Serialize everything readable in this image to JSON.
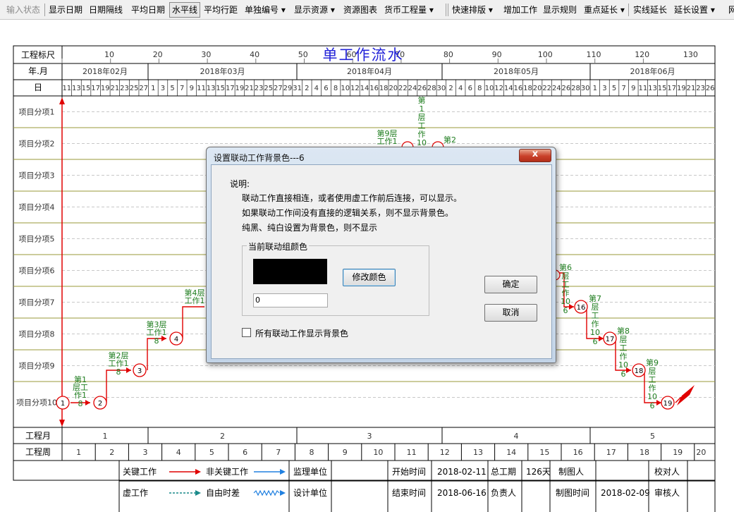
{
  "toolbar": {
    "items": [
      {
        "label": "输入状态",
        "state": "disabled"
      },
      {
        "label": "显示日期",
        "state": "normal"
      },
      {
        "label": "日期隔线",
        "state": "normal"
      },
      {
        "label": "平均日期",
        "state": "normal"
      },
      {
        "label": "水平线",
        "state": "active"
      },
      {
        "label": "平均行距",
        "state": "normal"
      },
      {
        "label": "单独编号 ▾",
        "state": "normal"
      },
      {
        "label": "显示资源 ▾",
        "state": "normal"
      },
      {
        "label": "资源图表",
        "state": "normal"
      },
      {
        "label": "货币工程量 ▾",
        "state": "normal"
      },
      {
        "label": "快速排版 ▾",
        "state": "normal"
      },
      {
        "label": "增加工作",
        "state": "normal"
      },
      {
        "label": "显示规则",
        "state": "normal"
      },
      {
        "label": "重点延长 ▾",
        "state": "normal"
      },
      {
        "label": "实线延长",
        "state": "normal"
      },
      {
        "label": "延长设置 ▾",
        "state": "normal"
      },
      {
        "label": "网",
        "state": "normal"
      }
    ]
  },
  "chart": {
    "title": "单工作流水",
    "scale_label": "工程标尺",
    "yearmonth_label": "年.月",
    "day_label": "日",
    "scale_ticks": [
      "10",
      "20",
      "30",
      "40",
      "50",
      "60",
      "70",
      "80",
      "90",
      "100",
      "110",
      "120",
      "130"
    ],
    "months": [
      "2018年02月",
      "2018年03月",
      "2018年04月",
      "2018年05月",
      "2018年06月"
    ],
    "days": [
      "11",
      "13",
      "15",
      "17",
      "19",
      "21",
      "23",
      "25",
      "27",
      "1",
      "3",
      "5",
      "7",
      "9",
      "11",
      "13",
      "15",
      "17",
      "19",
      "21",
      "23",
      "25",
      "27",
      "29",
      "31",
      "2",
      "4",
      "6",
      "8",
      "10",
      "12",
      "14",
      "16",
      "18",
      "20",
      "22",
      "24",
      "26",
      "28",
      "30",
      "2",
      "4",
      "6",
      "8",
      "10",
      "12",
      "14",
      "16",
      "18",
      "20",
      "22",
      "24",
      "26",
      "28",
      "30",
      "1",
      "3",
      "5",
      "7",
      "9",
      "11",
      "13",
      "15",
      "17",
      "19",
      "21",
      "23",
      "26"
    ],
    "rows": [
      "项目分项1",
      "项目分项2",
      "项目分项3",
      "项目分项4",
      "项目分项5",
      "项目分项6",
      "项目分项7",
      "项目分项8",
      "项目分项9",
      "项目分项10"
    ],
    "work_month_label": "工程月",
    "work_months": [
      "1",
      "2",
      "3",
      "4",
      "5"
    ],
    "work_week_label": "工程周",
    "work_weeks": [
      "1",
      "2",
      "3",
      "4",
      "5",
      "6",
      "7",
      "8",
      "9",
      "10",
      "11",
      "12",
      "13",
      "14",
      "15",
      "16",
      "17",
      "18",
      "19",
      "20"
    ],
    "nodes": [
      "1",
      "2",
      "3",
      "4",
      "16",
      "17",
      "18",
      "19",
      "1",
      "2"
    ],
    "node_labels": {
      "n1": "1",
      "n2": "2",
      "n3": "3",
      "n4": "4",
      "n16": "16",
      "n17": "17",
      "n18": "18",
      "n19": "19"
    },
    "work_labels": [
      {
        "lines": [
          "第1",
          "层工",
          "作1"
        ],
        "dur": "8"
      },
      {
        "lines": [
          "第2层",
          "工作1"
        ],
        "dur": "8"
      },
      {
        "lines": [
          "第3层",
          "工作1"
        ],
        "dur": "8"
      },
      {
        "lines": [
          "第4层",
          "工作1"
        ],
        "dur": ""
      },
      {
        "lines": [
          "第9层",
          "工作1"
        ],
        "dur": ""
      },
      {
        "lines": [
          "第",
          "1",
          "层",
          "工",
          "作",
          "10"
        ],
        "dur": ""
      },
      {
        "lines": [
          "第2"
        ],
        "dur": ""
      },
      {
        "lines": [
          "第6",
          "层",
          "工",
          "作",
          "10"
        ],
        "dur": "6"
      },
      {
        "lines": [
          "第7",
          "层",
          "工",
          "作",
          "10"
        ],
        "dur": "6"
      },
      {
        "lines": [
          "第8",
          "层",
          "工",
          "作",
          "10"
        ],
        "dur": "6"
      },
      {
        "lines": [
          "第9",
          "层",
          "工",
          "作",
          "10"
        ],
        "dur": "6"
      }
    ]
  },
  "legend": {
    "critical": "关键工作",
    "noncritical": "非关键工作",
    "dummy": "虚工作",
    "free_float": "自由时差",
    "supervisor": "监理单位",
    "designer": "设计单位",
    "start_time_label": "开始时间",
    "start_time": "2018-02-11",
    "end_time_label": "结束时间",
    "end_time": "2018-06-16",
    "total_duration_label": "总工期",
    "total_duration": "126天",
    "responsible_label": "负责人",
    "drawer_label": "制图人",
    "drawing_time_label": "制图时间",
    "drawing_time": "2018-02-09",
    "checker_label": "校对人",
    "reviewer_label": "审核人"
  },
  "dialog": {
    "title": "设置联动工作背景色---6",
    "close_symbol": "x",
    "explain_heading": "说明:",
    "line1": "联动工作直接相连，或者使用虚工作前后连接，可以显示。",
    "line2": "如果联动工作间没有直接的逻辑关系，则不显示背景色。",
    "line3": "纯黑、纯白设置为背景色，则不显示",
    "group_label": "当前联动组颜色",
    "color_value": "0",
    "modify_button": "修改颜色",
    "ok_button": "确定",
    "cancel_button": "取消",
    "checkbox_label": "所有联动工作显示背景色",
    "swatch_color": "#000000"
  }
}
